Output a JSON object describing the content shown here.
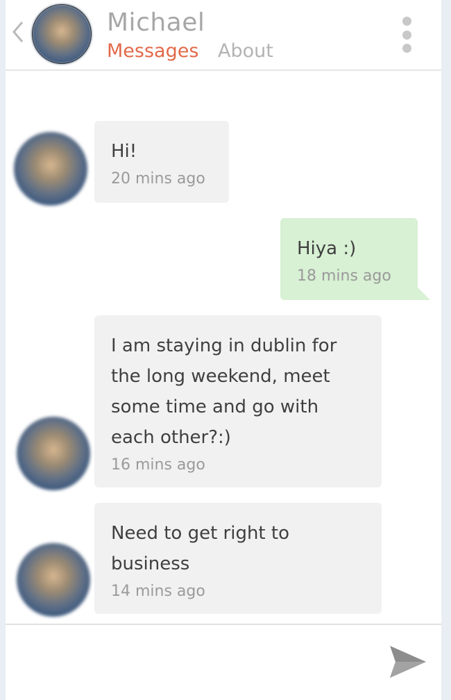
{
  "header": {
    "back_icon": "chevron-left-icon",
    "contact_name": "Michael",
    "tabs": [
      {
        "label": "Messages",
        "active": true
      },
      {
        "label": "About",
        "active": false
      }
    ],
    "menu_icon": "more-vertical-icon"
  },
  "messages": [
    {
      "sender": "contact",
      "text": "Hi!",
      "time": "20 mins ago"
    },
    {
      "sender": "me",
      "text": "Hiya :)",
      "time": "18 mins ago"
    },
    {
      "sender": "contact",
      "text": "I am staying in dublin for the long weekend, meet some time and go with each other?:)",
      "time": "16 mins ago"
    },
    {
      "sender": "contact",
      "text": "Need to get right to business",
      "time": "14 mins ago"
    }
  ],
  "composer": {
    "input_value": "",
    "placeholder": "",
    "send_icon": "send-icon"
  },
  "colors": {
    "accent": "#e2694a",
    "tab_inactive": "#b3b3b3",
    "outgoing_bubble": "#d8f0d4",
    "incoming_bubble": "#f1f1f1",
    "text": "#3f3f3f",
    "timestamp": "#9a9a9a"
  }
}
